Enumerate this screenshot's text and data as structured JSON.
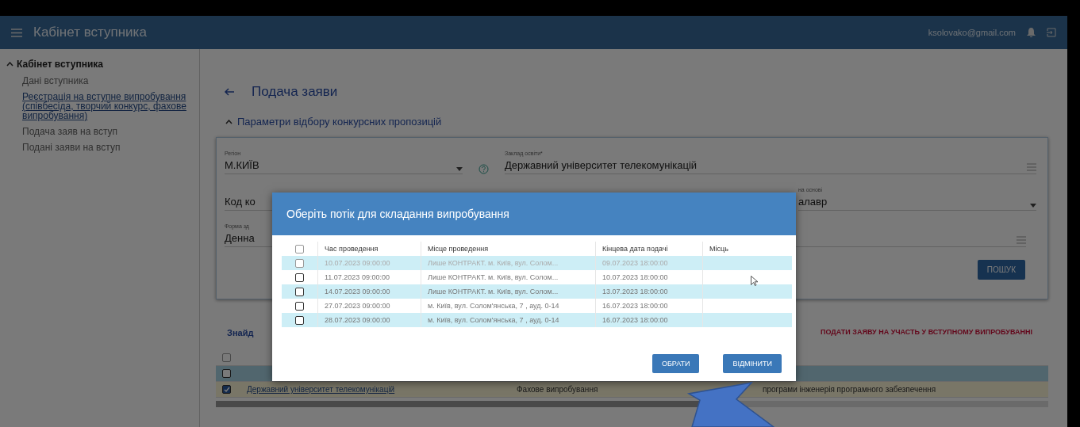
{
  "header": {
    "title": "Кабінет вступника",
    "email": "ksolovako@gmail.com"
  },
  "sidebar": {
    "title": "Кабінет вступника",
    "expanded": true,
    "items": [
      {
        "label": "Дані вступника",
        "selected": false
      },
      {
        "label": "Реєстрація на вступне випробування (співбесіда, творчий конкурс, фахове випробування)",
        "selected": true
      },
      {
        "label": "Подача заяв на вступ",
        "selected": false
      },
      {
        "label": "Подані заяви на вступ",
        "selected": false
      }
    ]
  },
  "page": {
    "title": "Подача заяви",
    "section": "Параметри відбору конкурсних пропозицій",
    "section_expanded": true
  },
  "filters": {
    "region": {
      "label": "Регіон",
      "value": "М.КИЇВ"
    },
    "institution": {
      "label": "Заклад освіти*",
      "value": "Державний університет телекомунікацій"
    },
    "code": {
      "label": "Код ко"
    },
    "basis": {
      "label": "на основі",
      "value": "алавр"
    },
    "form": {
      "label": "Форма зд",
      "value": "Денна"
    },
    "search_button": "ПОШУК"
  },
  "results": {
    "title": "Знайд",
    "apply_link": "ПОДАТИ ЗАЯВУ НА УЧАСТЬ У ВСТУПНОМУ ВИПРОБУВАННІ",
    "header_checked": false,
    "rows": [
      {
        "checked": false,
        "cells": []
      },
      {
        "checked": true,
        "cells": [
          "Державний університет телекомунікацій",
          "Фахове випробування",
          "програми інженерія програмного забезпечення"
        ]
      }
    ]
  },
  "dialog": {
    "title": "Оберіть потік для складання випробування",
    "columns": [
      "Час проведення",
      "Місце проведення",
      "Кінцева дата подачі",
      "Місць"
    ],
    "all_checked": false,
    "rows": [
      {
        "checked": false,
        "disabled": true,
        "cells": [
          "10.07.2023 09:00:00",
          "Лише КОНТРАКТ. м. Київ, вул. Солом...",
          "09.07.2023 18:00:00",
          ""
        ]
      },
      {
        "checked": false,
        "disabled": false,
        "cells": [
          "11.07.2023 09:00:00",
          "Лише КОНТРАКТ. м. Київ, вул. Солом...",
          "10.07.2023 18:00:00",
          ""
        ]
      },
      {
        "checked": false,
        "disabled": false,
        "cells": [
          "14.07.2023 09:00:00",
          "Лише КОНТРАКТ. м. Київ, вул. Солом...",
          "13.07.2023 18:00:00",
          ""
        ]
      },
      {
        "checked": false,
        "disabled": false,
        "cells": [
          "27.07.2023 09:00:00",
          "м. Київ, вул. Солом'янська, 7 , ауд. 0-14",
          "16.07.2023 18:00:00",
          ""
        ]
      },
      {
        "checked": false,
        "disabled": false,
        "cells": [
          "28.07.2023 09:00:00",
          "м. Київ, вул. Солом'янська, 7 , ауд. 0-14",
          "16.07.2023 18:00:00",
          ""
        ]
      }
    ],
    "buttons": [
      "ОБРАТИ",
      "ВІДМІНИТИ"
    ]
  }
}
